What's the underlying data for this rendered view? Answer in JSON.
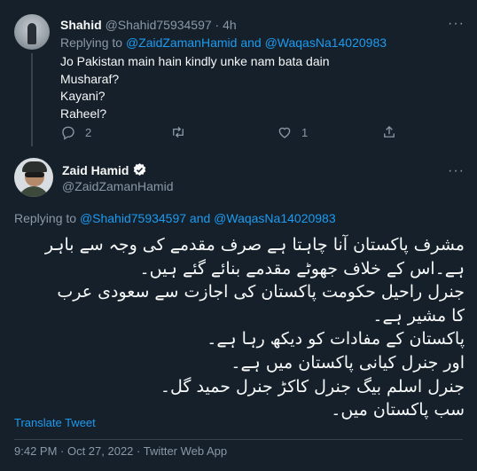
{
  "reply": {
    "name": "Shahid",
    "handle": "@Shahid75934597",
    "time": "4h",
    "replying_prefix": "Replying to",
    "replying_to_1": "@ZaidZamanHamid",
    "replying_and": "and",
    "replying_to_2": "@WaqasNa14020983",
    "lines": [
      "Jo Pakistan main hain kindly unke nam bata dain",
      "Musharaf?",
      "Kayani?",
      "Raheel?"
    ],
    "reply_count": "2",
    "like_count": "1"
  },
  "main": {
    "name": "Zaid Hamid",
    "handle": "@ZaidZamanHamid",
    "replying_prefix": "Replying to",
    "replying_to_1": "@Shahid75934597",
    "replying_and": "and",
    "replying_to_2": "@WaqasNa14020983",
    "urdu_lines": [
      "مشرف پاکستان آنا چاہتا ہے صرف مقدمے کی وجہ سے باہر",
      "ہے۔اس کے خلاف جھوٹے مقدمے بنائے گئے ہیں۔",
      "جنرل راحیل حکومت پاکستان کی اجازت سے سعودی عرب",
      "کا مشیر ہے۔",
      "پاکستان کے مفادات کو دیکھ رہا ہے۔",
      "اور جنرل کیانی پاکستان میں ہے۔",
      "جنرل اسلم بیگ جنرل کاکڑ جنرل حمید گل۔",
      "سب پاکستان میں۔"
    ],
    "translate_label": "Translate Tweet",
    "meta": "9:42 PM · Oct 27, 2022 · Twitter Web App"
  },
  "icons": {
    "reply": "reply-icon",
    "retweet": "retweet-icon",
    "like": "like-icon",
    "share": "share-icon",
    "more": "more-icon",
    "verified": "verified-badge-icon"
  },
  "colors": {
    "background": "#15202b",
    "accent": "#1d9bf0",
    "muted": "#8b98a5",
    "text": "#f7f9f9"
  }
}
